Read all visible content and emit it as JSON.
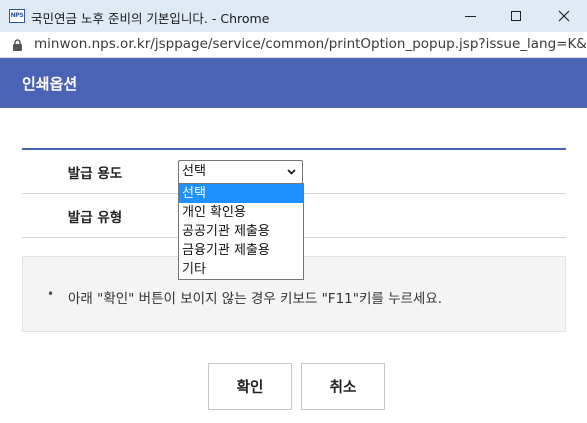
{
  "window": {
    "title": "국민연금 노후 준비의 기본입니다. - Chrome",
    "favicon_text": "NPS"
  },
  "address_bar": {
    "url": "minwon.nps.or.kr/jsppage/service/common/printOption_popup.jsp?issue_lang=K&..."
  },
  "popup": {
    "title": "인쇄옵션"
  },
  "options": {
    "purpose": {
      "label": "발급 용도",
      "selected": "선택",
      "items": [
        "선택",
        "개인 확인용",
        "공공기관 제출용",
        "금융기관 제출용",
        "기타"
      ]
    },
    "type": {
      "label": "발급 유형"
    }
  },
  "notice": {
    "bullet": "•",
    "text": "아래 \"확인\" 버튼이 보이지 않는 경우 키보드 \"F11\"키를 누르세요."
  },
  "buttons": {
    "ok": "확인",
    "cancel": "취소"
  },
  "colors": {
    "header": "#4a63b5",
    "dropdown_highlight": "#1e90ff",
    "titlebar": "#dfeaf5"
  }
}
